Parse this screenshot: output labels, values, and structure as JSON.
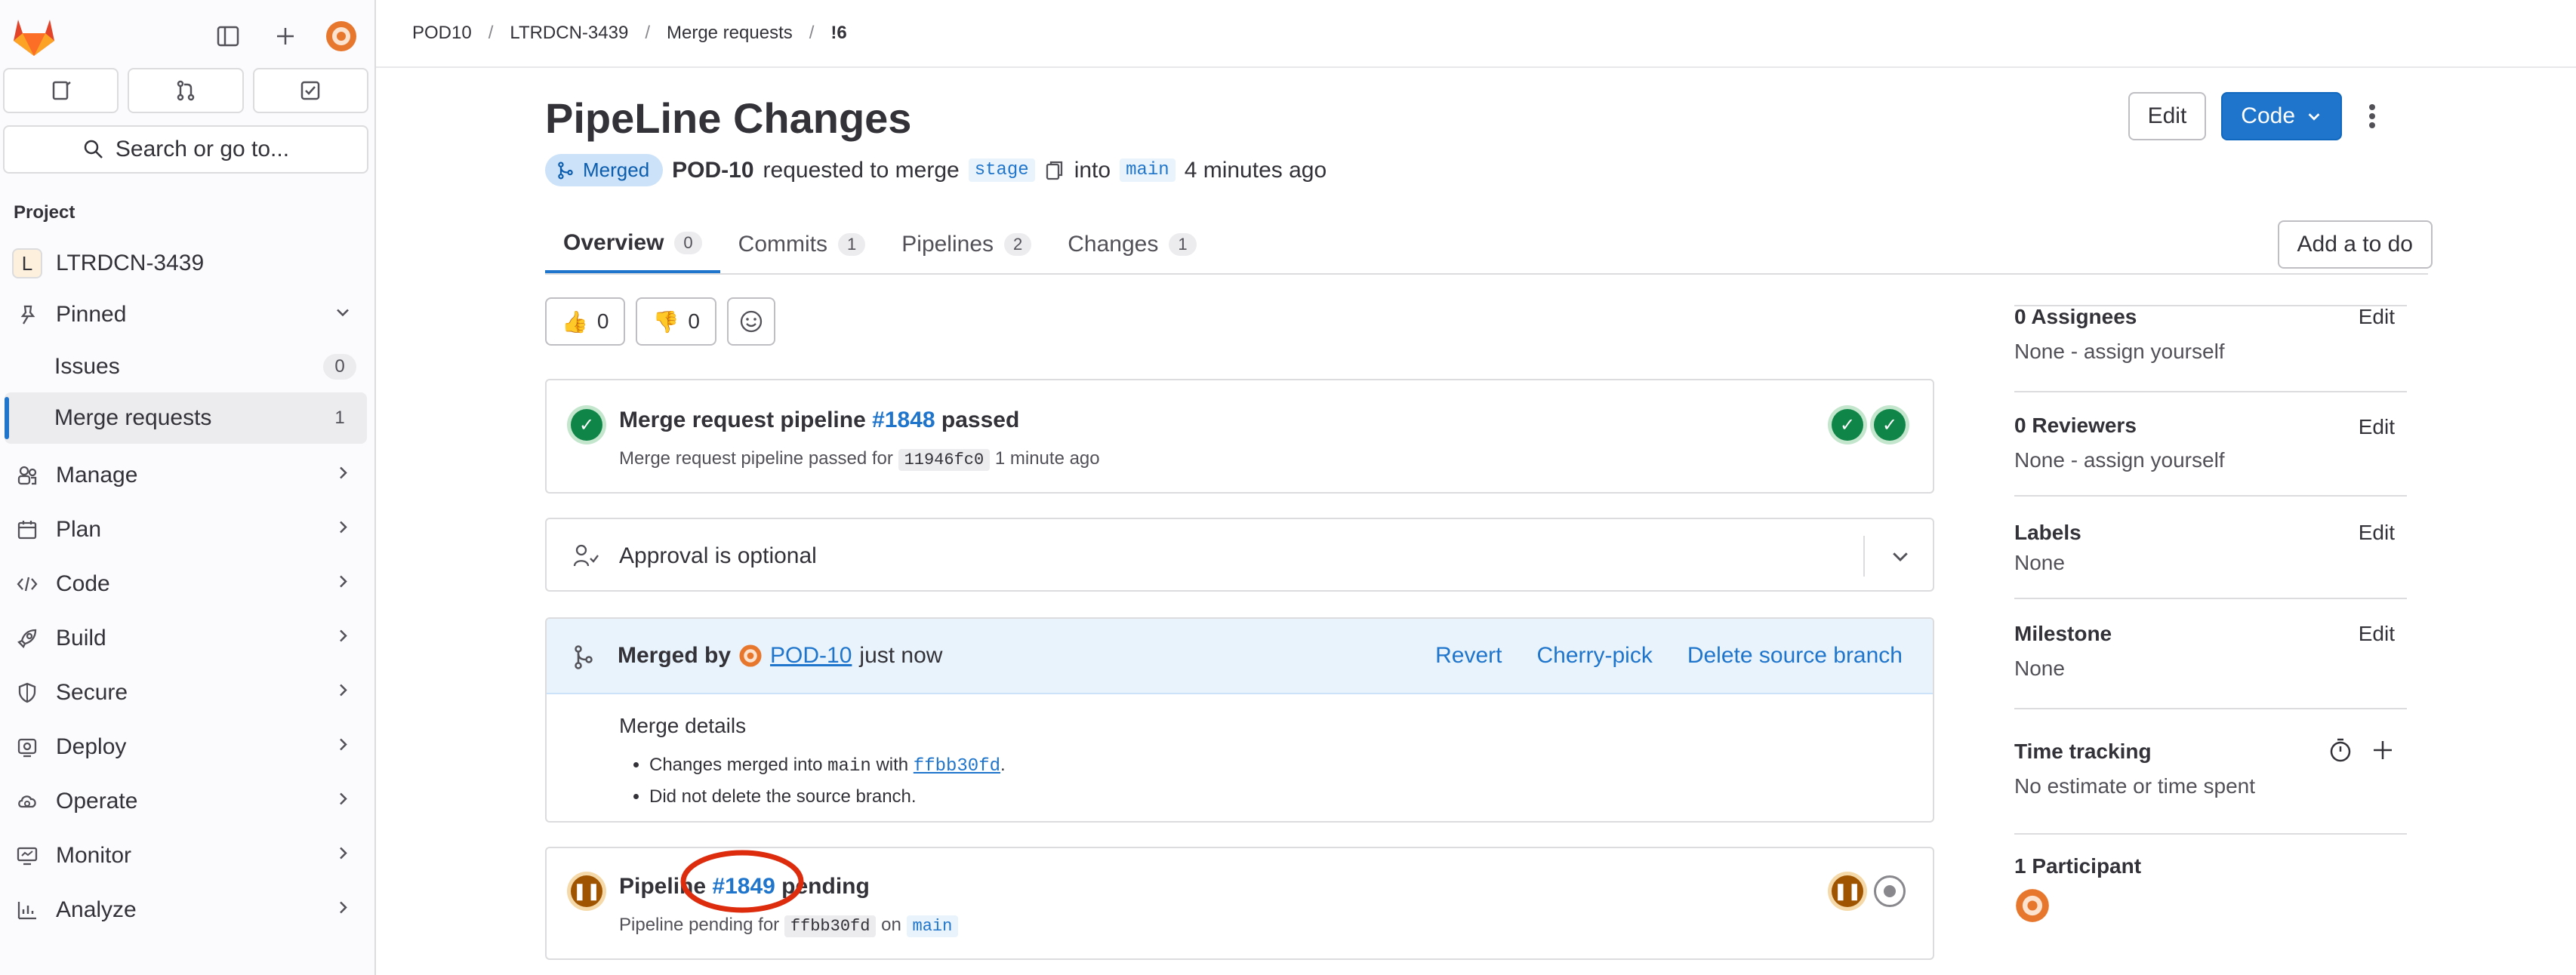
{
  "sidebar": {
    "search_placeholder": "Search or go to...",
    "section_label": "Project",
    "project": {
      "initial": "L",
      "name": "LTRDCN-3439"
    },
    "pinned_label": "Pinned",
    "pinned_items": [
      {
        "label": "Issues",
        "count": "0"
      },
      {
        "label": "Merge requests",
        "count": "1"
      }
    ],
    "nav_items": [
      {
        "label": "Manage",
        "icon": "users-icon"
      },
      {
        "label": "Plan",
        "icon": "calendar-icon"
      },
      {
        "label": "Code",
        "icon": "code-icon"
      },
      {
        "label": "Build",
        "icon": "rocket-icon"
      },
      {
        "label": "Secure",
        "icon": "shield-icon"
      },
      {
        "label": "Deploy",
        "icon": "deploy-icon"
      },
      {
        "label": "Operate",
        "icon": "cloud-icon"
      },
      {
        "label": "Monitor",
        "icon": "monitor-icon"
      },
      {
        "label": "Analyze",
        "icon": "chart-icon"
      }
    ]
  },
  "breadcrumb": [
    "POD10",
    "LTRDCN-3439",
    "Merge requests",
    "!6"
  ],
  "mr": {
    "title": "PipeLine Changes",
    "status": "Merged",
    "author": "POD-10",
    "requested_text": "requested to merge",
    "source_branch": "stage",
    "into_text": "into",
    "target_branch": "main",
    "time_ago": "4 minutes ago",
    "edit_label": "Edit",
    "code_label": "Code"
  },
  "tabs": [
    {
      "label": "Overview",
      "count": "0"
    },
    {
      "label": "Commits",
      "count": "1"
    },
    {
      "label": "Pipelines",
      "count": "2"
    },
    {
      "label": "Changes",
      "count": "1"
    }
  ],
  "todo_label": "Add a to do",
  "reactions": {
    "thumbs_up": "0",
    "thumbs_down": "0"
  },
  "pipeline1": {
    "prefix": "Merge request pipeline",
    "id": "#1848",
    "suffix": "passed",
    "sub_prefix": "Merge request pipeline passed for",
    "sha": "11946fc0",
    "sub_time": "1 minute ago"
  },
  "approval": {
    "text": "Approval is optional"
  },
  "merged": {
    "by_label": "Merged by",
    "user": "POD-10",
    "when": "just now",
    "revert": "Revert",
    "cherry_pick": "Cherry-pick",
    "delete_branch": "Delete source branch",
    "details_title": "Merge details",
    "detail1_prefix": "Changes merged into",
    "detail1_branch": "main",
    "detail1_with": "with",
    "detail1_sha": "ffbb30fd",
    "detail2": "Did not delete the source branch."
  },
  "pipeline2": {
    "prefix": "Pipeline",
    "id": "#1849",
    "suffix": "pending",
    "sub_prefix": "Pipeline pending for",
    "sha": "ffbb30fd",
    "on_text": "on",
    "branch": "main"
  },
  "right": {
    "assignees_label": "0 Assignees",
    "assignees_value": "None - assign yourself",
    "reviewers_label": "0 Reviewers",
    "reviewers_value": "None - assign yourself",
    "labels_label": "Labels",
    "labels_value": "None",
    "milestone_label": "Milestone",
    "milestone_value": "None",
    "time_label": "Time tracking",
    "time_value": "No estimate or time spent",
    "participants_label": "1 Participant",
    "edit": "Edit"
  },
  "colors": {
    "accent": "#1f75cb",
    "success": "#108548",
    "pending": "#9e5400",
    "annotation": "#dd2b0e"
  }
}
